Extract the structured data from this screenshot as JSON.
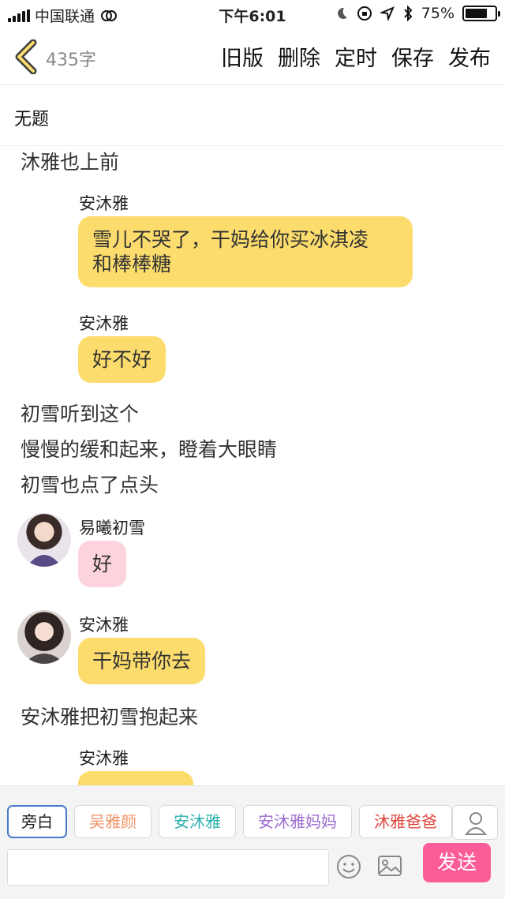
{
  "status_bar": {
    "carrier": "中国联通",
    "time": "下午6:01",
    "battery": "75%",
    "battery_level": 0.75
  },
  "header": {
    "word_count": "435字",
    "actions": [
      "旧版",
      "删除",
      "定时",
      "保存",
      "发布"
    ]
  },
  "title": "无题",
  "story": {
    "narration_1": "沐雅也上前",
    "msg_1": {
      "speaker": "安沐雅",
      "text_line1": "雪儿不哭了，干妈给你买冰淇凌",
      "text_line2": "和棒棒糖"
    },
    "msg_2": {
      "speaker": "安沐雅",
      "text": "好不好"
    },
    "narration_2": "初雪听到这个",
    "narration_3": "慢慢的缓和起来，瞪着大眼睛",
    "narration_4": "初雪也点了点头",
    "msg_3": {
      "speaker": "易曦初雪",
      "text": "好"
    },
    "msg_4": {
      "speaker": "安沐雅",
      "text": "干妈带你去"
    },
    "narration_5": "安沐雅把初雪抱起来",
    "msg_5": {
      "speaker": "安沐雅",
      "text": ""
    }
  },
  "bottom_bar": {
    "roles": [
      {
        "label": "旁白",
        "color": "#222222"
      },
      {
        "label": "吴雅颜",
        "color": "#f0956a"
      },
      {
        "label": "安沐雅",
        "color": "#2bb0ad"
      },
      {
        "label": "安沐雅妈妈",
        "color": "#9d6bd0"
      },
      {
        "label": "沐雅爸爸",
        "color": "#e0473e"
      }
    ],
    "input_placeholder": "",
    "send_label": "发送"
  },
  "colors": {
    "accent_yellow": "#fbdc6c",
    "send_pink": "#fc5c97",
    "bubble_pink": "#fdd3dd"
  }
}
